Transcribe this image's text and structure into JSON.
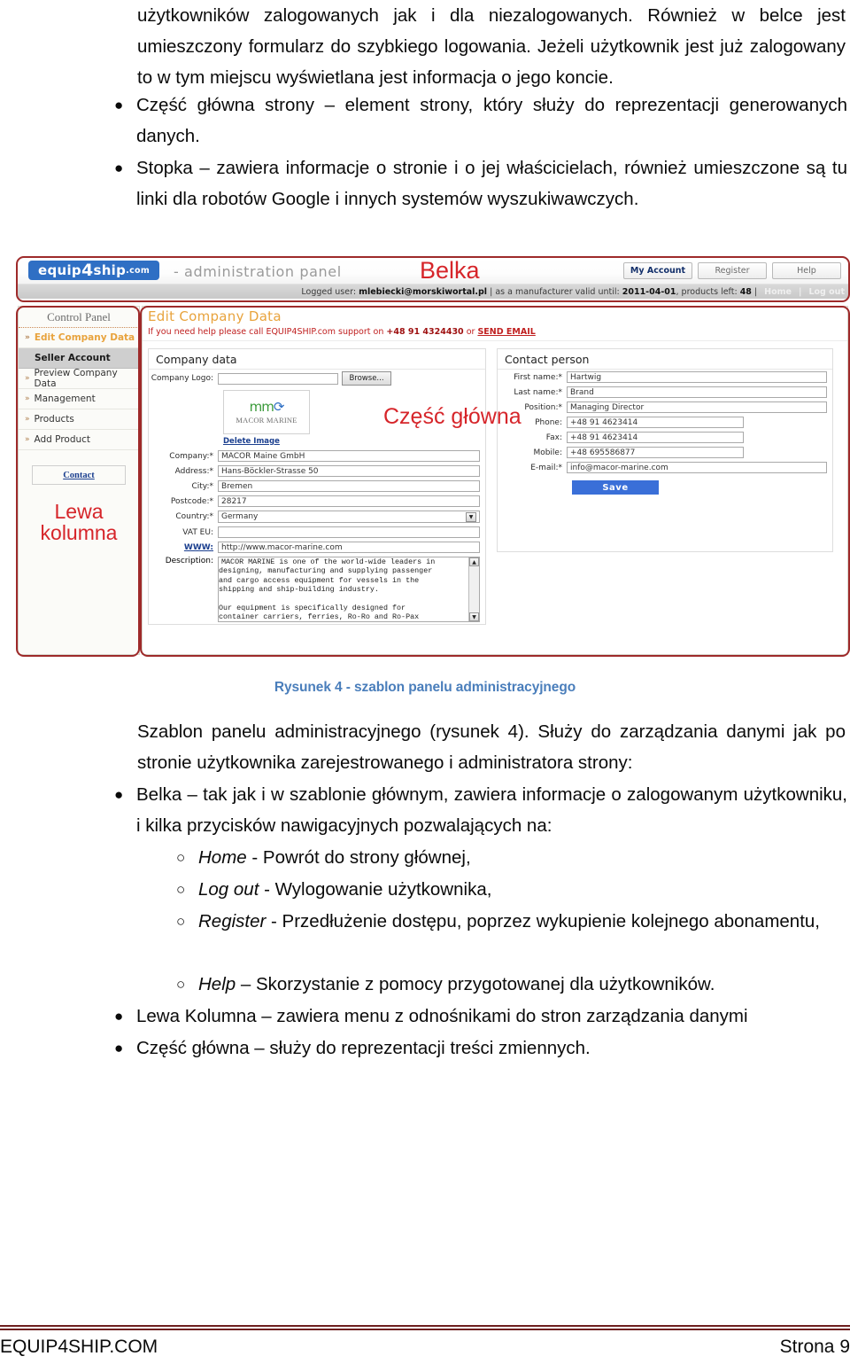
{
  "doc": {
    "top_paragraph": "użytkowników zalogowanych jak i dla niezalogowanych. Również w belce jest umieszczony formularz do szybkiego logowania. Jeżeli użytkownik jest już zalogowany to w tym miejscu wyświetlana jest informacja o jego koncie.",
    "bullets_top": [
      {
        "mark": "●",
        "text": "Część główna strony – element strony, który służy do reprezentacji generowanych danych."
      },
      {
        "mark": "●",
        "text": "Stopka – zawiera informacje o stronie i o jej właścicielach, również umieszczone są tu linki dla robotów Google i innych systemów wyszukiwawczych."
      }
    ],
    "figure_caption": "Rysunek 4 - szablon panelu administracyjnego",
    "paragraph_after": "Szablon panelu administracyjnego (rysunek 4). Służy do zarządzania danymi jak po stronie użytkownika zarejestrowanego  i administratora strony:",
    "bullets_bottom": [
      {
        "mark": "●",
        "text": "Belka – tak jak i w szablonie głównym, zawiera informacje o zalogowanym użytkowniku, i kilka przycisków nawigacyjnych pozwalających na:"
      }
    ],
    "sub_bullets": [
      {
        "mark": "○",
        "ital": "Home",
        "text": " - Powrót do strony głównej,"
      },
      {
        "mark": "○",
        "ital": "Log out",
        "text": " - Wylogowanie użytkownika,"
      },
      {
        "mark": "○",
        "ital": "Register",
        "text": " - Przedłużenie dostępu, poprzez wykupienie kolejnego abonamentu,"
      },
      {
        "mark": "○",
        "ital": "Help",
        "text": " – Skorzystanie z pomocy przygotowanej dla użytkowników."
      }
    ],
    "bullets_tail": [
      {
        "mark": "●",
        "text": "Lewa Kolumna – zawiera menu z odnośnikami do stron zarządzania danymi"
      },
      {
        "mark": "●",
        "text": "Część główna – służy do reprezentacji treści zmiennych."
      }
    ],
    "footer": {
      "left": "EQUIP4SHIP.COM",
      "right": "Strona 9"
    }
  },
  "annotations": {
    "belka": "Belka",
    "czesc_glowna": "Część główna",
    "lewa_kolumna": "Lewa\nkolumna",
    "color": "#d6252a"
  },
  "screenshot": {
    "brand": {
      "part1": "equip",
      "part2": "4",
      "part3": "ship",
      "dotcom": ".com"
    },
    "admin_title": "- administration panel",
    "top_buttons": [
      {
        "label": "My Account"
      },
      {
        "label": "Register"
      },
      {
        "label": "Help"
      }
    ],
    "status": {
      "prefix": "Logged user:",
      "user": "mlebiecki@morskiwortal.pl",
      "middle": "| as a manufacturer valid until:",
      "valid_until": "2011-04-01",
      "products_prefix": ", products left:",
      "products_left": "48",
      "pipe": "|",
      "home": "Home",
      "sep": "|",
      "logout": "Log out"
    },
    "sidebar": {
      "title": "Control Panel",
      "items": [
        {
          "label": "Edit Company Data",
          "active": true,
          "chev": "»"
        },
        {
          "label": "Seller Account",
          "sub": true
        },
        {
          "label": "Preview Company Data",
          "chev": "»"
        },
        {
          "label": "Management",
          "chev": "»"
        },
        {
          "label": "Products",
          "chev": "»"
        },
        {
          "label": "Add Product",
          "chev": "»"
        }
      ],
      "contact_button": "Contact"
    },
    "main": {
      "page_title": "Edit Company Data",
      "help_pre": "If you need help please call EQUIP4SHIP.com support on",
      "help_phone": "+48 91 4324430",
      "help_or": "or",
      "help_link": "SEND EMAIL",
      "company_legend": "Company data",
      "logo_label": "Company Logo:",
      "logo_value": "",
      "browse_label": "Browse...",
      "logo_mark": "mm",
      "logo_name": "MACOR MARINE",
      "delete_image": "Delete Image",
      "company_fields": [
        {
          "label": "Company:*",
          "value": "MACOR Maine GmbH",
          "width": "full"
        },
        {
          "label": "Address:*",
          "value": "Hans-Böckler-Strasse 50",
          "width": "full"
        },
        {
          "label": "City:*",
          "value": "Bremen",
          "width": "full"
        },
        {
          "label": "Postcode:*",
          "value": "28217",
          "width": "full"
        },
        {
          "label": "Country:*",
          "value": "Germany",
          "width": "select"
        },
        {
          "label": "VAT EU:",
          "value": "",
          "width": "full"
        },
        {
          "label": "WWW:",
          "value": "http://www.macor-marine.com",
          "width": "full",
          "link": true
        }
      ],
      "description_label": "Description:",
      "description_value": "MACOR MARINE is one of the world-wide leaders in\ndesigning, manufacturing and supplying passenger\nand cargo access equipment for vessels in the\nshipping and ship-building industry.\n\nOur equipment is specifically designed for\ncontainer carriers, ferries, Ro-Ro and Ro-Pax",
      "contact_legend": "Contact person",
      "contact_fields": [
        {
          "label": "First name:*",
          "value": "Hartwig",
          "width": "full"
        },
        {
          "label": "Last name:*",
          "value": "Brand",
          "width": "full"
        },
        {
          "label": "Position:*",
          "value": "Managing Director",
          "width": "full"
        },
        {
          "label": "Phone:",
          "value": "+48 91 4623414",
          "width": "med"
        },
        {
          "label": "Fax:",
          "value": "+48 91 4623414",
          "width": "med"
        },
        {
          "label": "Mobile:",
          "value": "+48 695586877",
          "width": "med"
        },
        {
          "label": "E-mail:*",
          "value": "info@macor-marine.com",
          "width": "full"
        }
      ],
      "save_label": "Save"
    }
  }
}
